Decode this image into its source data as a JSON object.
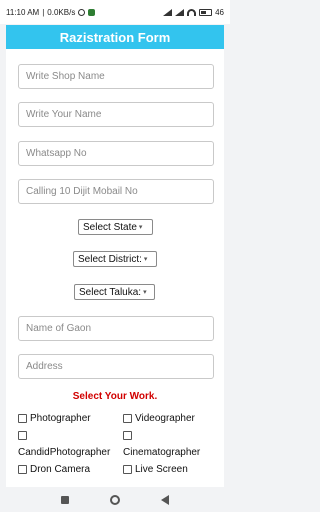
{
  "status_bar": {
    "time": "11:10 AM",
    "speed": "0.0KB/s",
    "battery": "46"
  },
  "header": {
    "title": "Razistration Form"
  },
  "fields": {
    "shop_name": "Write Shop Name",
    "your_name": "Write Your Name",
    "whatsapp": "Whatsapp No",
    "calling": "Calling 10 Dijit Mobail No",
    "gaon": "Name of Gaon",
    "address": "Address"
  },
  "selects": {
    "state": "Select State",
    "district": "Select District:",
    "taluka": "Select Taluka:"
  },
  "work": {
    "heading": "Select Your Work.",
    "options": [
      "Photographer",
      "Videographer",
      "CandidPhotographer",
      "Cinematographer",
      "Dron Camera",
      "Live Screen"
    ]
  }
}
